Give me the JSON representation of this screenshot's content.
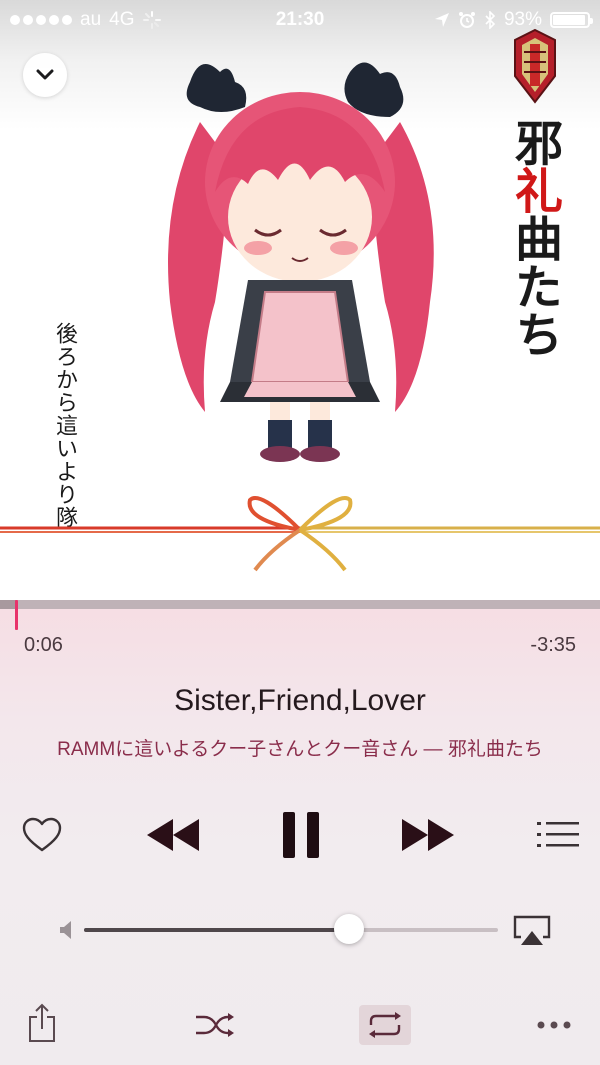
{
  "status_bar": {
    "carrier": "au",
    "network": "4G",
    "time": "21:30",
    "battery_percent": "93%",
    "battery_level": 0.93
  },
  "artwork": {
    "album_title_chars": [
      "邪",
      "礼",
      "曲",
      "た",
      "ち"
    ],
    "subtitle_vertical": "後ろから這いより隊"
  },
  "player": {
    "elapsed": "0:06",
    "remaining": "-3:35",
    "progress": 0.027,
    "title": "Sister,Friend,Lover",
    "subtitle": "RAMMに這いよるクー子さんとクー音さん — 邪礼曲たち",
    "volume": 0.64,
    "repeat_active": true
  },
  "colors": {
    "accent": "#e8336b",
    "subtitle_text": "#8a2d4b",
    "album_red": "#d01818"
  },
  "icons": {
    "collapse": "chevron-down-icon",
    "love": "heart-icon",
    "rewind": "rewind-icon",
    "pause": "pause-icon",
    "forward": "fast-forward-icon",
    "list": "list-icon",
    "volume_low": "speaker-icon",
    "airplay": "airplay-icon",
    "share": "share-icon",
    "shuffle": "shuffle-icon",
    "repeat": "repeat-icon",
    "more": "more-icon"
  }
}
